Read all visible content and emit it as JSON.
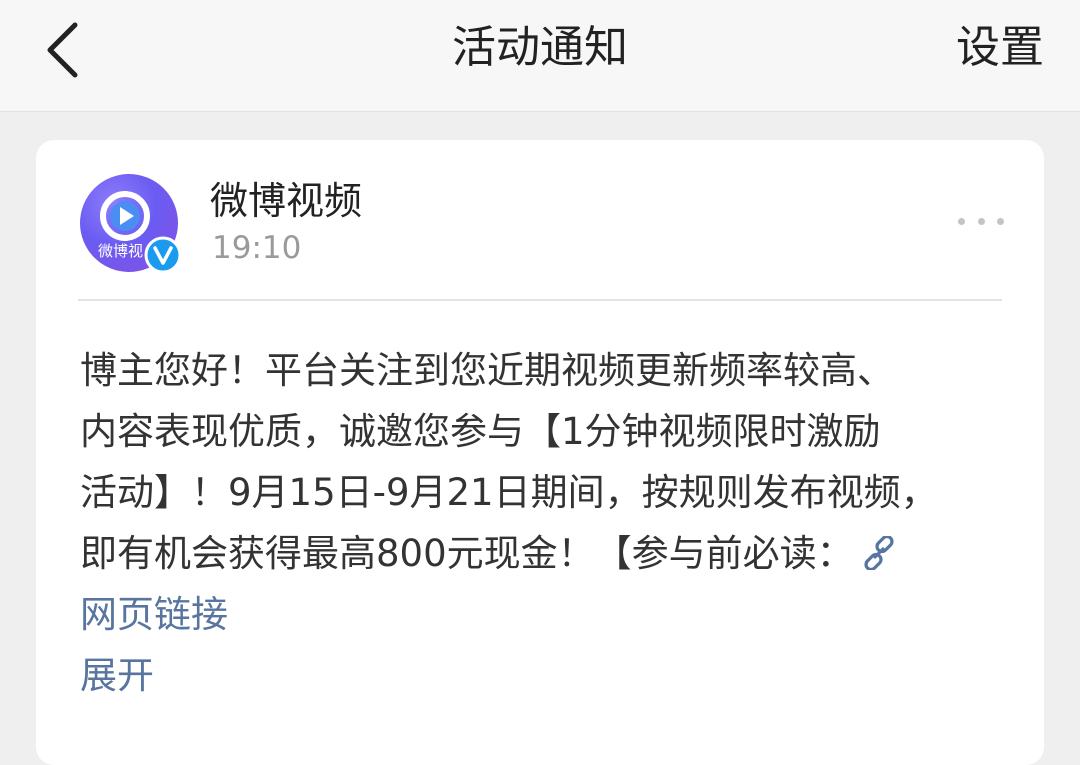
{
  "header": {
    "title": "活动通知",
    "settings_label": "设置"
  },
  "notification": {
    "sender": "微博视频",
    "avatar_text": "微博视",
    "time": "19:10",
    "body_lines": [
      "博主您好！平台关注到您近期视频更新频率较高、",
      "内容表现优质，诚邀您参与【1分钟视频限时激励",
      "活动】！9月15日-9月21日期间，按规则发布视频，",
      "即有机会获得最高800元现金！【参与前必读："
    ],
    "link_text": "网页链接",
    "expand_label": "展开"
  },
  "colors": {
    "link": "#57759e",
    "verified": "#1a9bf0",
    "avatar_purple": "#6a5cf2"
  },
  "icons": {
    "back": "chevron-left-icon",
    "more": "more-dots-icon",
    "link": "link-icon",
    "verified": "verified-v-icon",
    "avatar_play": "play-icon"
  }
}
